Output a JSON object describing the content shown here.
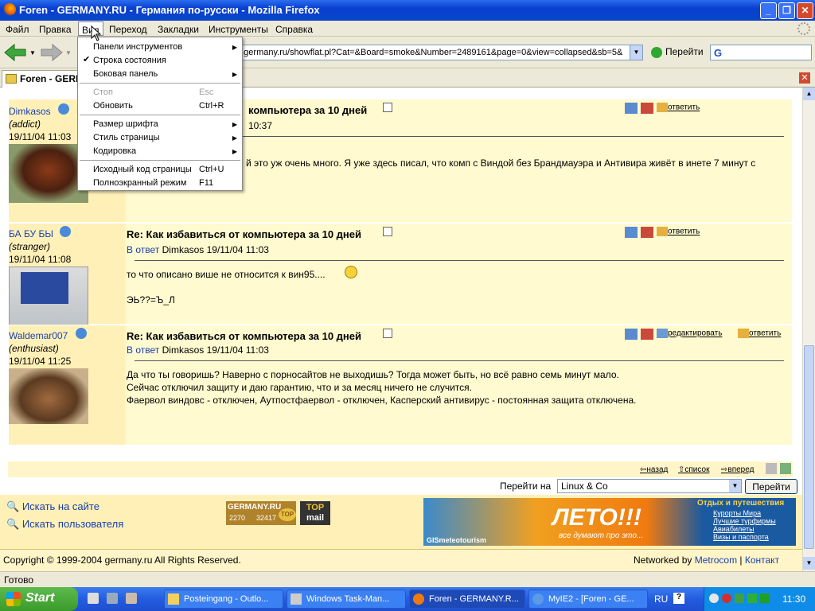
{
  "window": {
    "title": "Foren - GERMANY.RU - Германия по-русски - Mozilla Firefox"
  },
  "menubar": {
    "items": [
      "Файл",
      "Правка",
      "Вид",
      "Переход",
      "Закладки",
      "Инструменты",
      "Справка"
    ]
  },
  "navbar": {
    "url": "n.germany.ru/showflat.pl?Cat=&Board=smoke&Number=2489161&page=0&view=collapsed&sb=5&",
    "go_label": "Перейти",
    "search_icon": "G"
  },
  "tab": {
    "label": "Foren - GERMANY.RU"
  },
  "view_menu": {
    "items": [
      {
        "label": "Панели инструментов",
        "shortcut": "",
        "submenu": true,
        "checked": false,
        "disabled": false
      },
      {
        "label": "Строка состояния",
        "shortcut": "",
        "submenu": false,
        "checked": true,
        "disabled": false
      },
      {
        "label": "Боковая панель",
        "shortcut": "",
        "submenu": true,
        "checked": false,
        "disabled": false
      },
      {
        "label": "Стоп",
        "shortcut": "Esc",
        "submenu": false,
        "checked": false,
        "disabled": true
      },
      {
        "label": "Обновить",
        "shortcut": "Ctrl+R",
        "submenu": false,
        "checked": false,
        "disabled": false
      },
      {
        "label": "Размер шрифта",
        "shortcut": "",
        "submenu": true,
        "checked": false,
        "disabled": false
      },
      {
        "label": "Стиль страницы",
        "shortcut": "",
        "submenu": true,
        "checked": false,
        "disabled": false
      },
      {
        "label": "Кодировка",
        "shortcut": "",
        "submenu": true,
        "checked": false,
        "disabled": false
      },
      {
        "label": "Исходный код страницы",
        "shortcut": "Ctrl+U",
        "submenu": false,
        "checked": false,
        "disabled": false
      },
      {
        "label": "Полноэкранный режим",
        "shortcut": "F11",
        "submenu": false,
        "checked": false,
        "disabled": false
      }
    ]
  },
  "posts": [
    {
      "author": "Dimkasos",
      "status": "(addict)",
      "date": "19/11/04 11:03",
      "title": "компьютера за 10 дней",
      "time_fragment": "10:37",
      "text": "й это уж очень много. Я уже здесь писал, что комп с Виндой без Брандмауэра и Антивира живёт в инете 7 минут с",
      "reply_label": "ответить"
    },
    {
      "author": "БА БУ БЫ",
      "status": "(stranger)",
      "date": "19/11/04 11:08",
      "title": "Re: Как избавиться от компьютера за 10 дней",
      "in_reply_link": "В ответ",
      "in_reply_to": "Dimkasos 19/11/04 11:03",
      "text1": "то что описано више не относится к вин95....",
      "text2": "ЭЬ??=Ъ_Л",
      "reply_label": "ответить"
    },
    {
      "author": "Waldemar007",
      "status": "(enthusiast)",
      "date": "19/11/04 11:25",
      "title": "Re: Как избавиться от компьютера за 10 дней",
      "in_reply_link": "В ответ",
      "in_reply_to": "Dimkasos 19/11/04 11:03",
      "text1": "Да что ты говоришь? Наверно с порносайтов не выходишь? Тогда может быть, но всё равно семь минут мало.",
      "text2": "Сейчас отключил защиту и даю гарантию, что и за месяц ничего не случится.",
      "text3": "Фаервол виндовс - отключен, Аутпостфаервол - отключен, Касперский антивирус - постоянная защита отключена.",
      "edit_label": "редактировать",
      "reply_label": "ответить"
    }
  ],
  "pager": {
    "back": "назад",
    "list": "список",
    "forward": "вперед"
  },
  "jump": {
    "label": "Перейти на",
    "selected": "Linux & Co",
    "button": "Перейти"
  },
  "footer_links": {
    "search_site": "Искать на сайте",
    "search_user": "Искать пользователя"
  },
  "counter": {
    "brand": "GERMANY.RU",
    "num1": "2270",
    "num2": "32417",
    "top": "TOP",
    "top_mail_1": "TOP",
    "top_mail_2": "mail"
  },
  "banner": {
    "headline": "ЛЕТО!!!",
    "sub": "все думают про это...",
    "corner": "Отдых и путешествия",
    "links": [
      "Курорты Мира",
      "Лучшие турфирмы",
      "Авиабилеты",
      "Визы и паспорта"
    ],
    "brand": "GISmeteotourism"
  },
  "copyright": "Copyright © 1999-2004 germany.ru All Rights Reserved.",
  "networked": {
    "prefix": "Networked by",
    "company": "Metrocom",
    "contact": "Контакт"
  },
  "status_text": "Готово",
  "taskbar": {
    "start": "Start",
    "buttons": [
      "Posteingang - Outlo...",
      "Windows Task-Man...",
      "Foren - GERMANY.R...",
      "MyIE2 - [Foren - GE..."
    ],
    "lang": "RU",
    "time": "11:30"
  }
}
